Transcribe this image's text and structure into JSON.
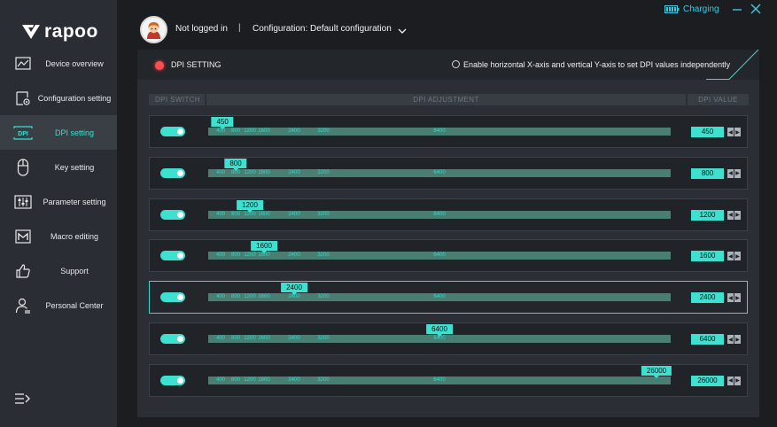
{
  "app": {
    "brand": "rapoo",
    "charging": "Charging"
  },
  "header": {
    "login": "Not logged in",
    "separator": "|",
    "configuration": "Configuration: Default configuration"
  },
  "sidebar": {
    "items": [
      {
        "label": "Device overview"
      },
      {
        "label": "Configuration setting"
      },
      {
        "label": "DPI setting"
      },
      {
        "label": "Key setting"
      },
      {
        "label": "Parameter setting"
      },
      {
        "label": "Macro editing"
      },
      {
        "label": "Support"
      },
      {
        "label": "Personal Center"
      }
    ],
    "active_index": 2
  },
  "dpi_panel": {
    "title": "DPI SETTING",
    "independent_axes_label": "Enable horizontal X-axis and vertical Y-axis to set DPI values independently",
    "columns": {
      "switch": "DPI SWITCH",
      "adjustment": "DPI ADJUSTMENT",
      "value": "DPI VALUE"
    },
    "tick_labels": [
      "400",
      "800",
      "1200",
      "1600",
      "2400",
      "3200",
      "6400"
    ],
    "slider_max": 26000,
    "selected_row": 4,
    "rows": [
      {
        "enabled": true,
        "value": "450"
      },
      {
        "enabled": true,
        "value": "800"
      },
      {
        "enabled": true,
        "value": "1200"
      },
      {
        "enabled": true,
        "value": "1600"
      },
      {
        "enabled": true,
        "value": "2400"
      },
      {
        "enabled": true,
        "value": "6400"
      },
      {
        "enabled": true,
        "value": "26000"
      }
    ]
  },
  "colors": {
    "accent": "#3ee0d0",
    "track": "#4a7e73",
    "sidebar": "#2a2d33",
    "panel": "#2b2e34",
    "status_dot": "#ff4d4d",
    "charging": "#3ec8e0"
  }
}
